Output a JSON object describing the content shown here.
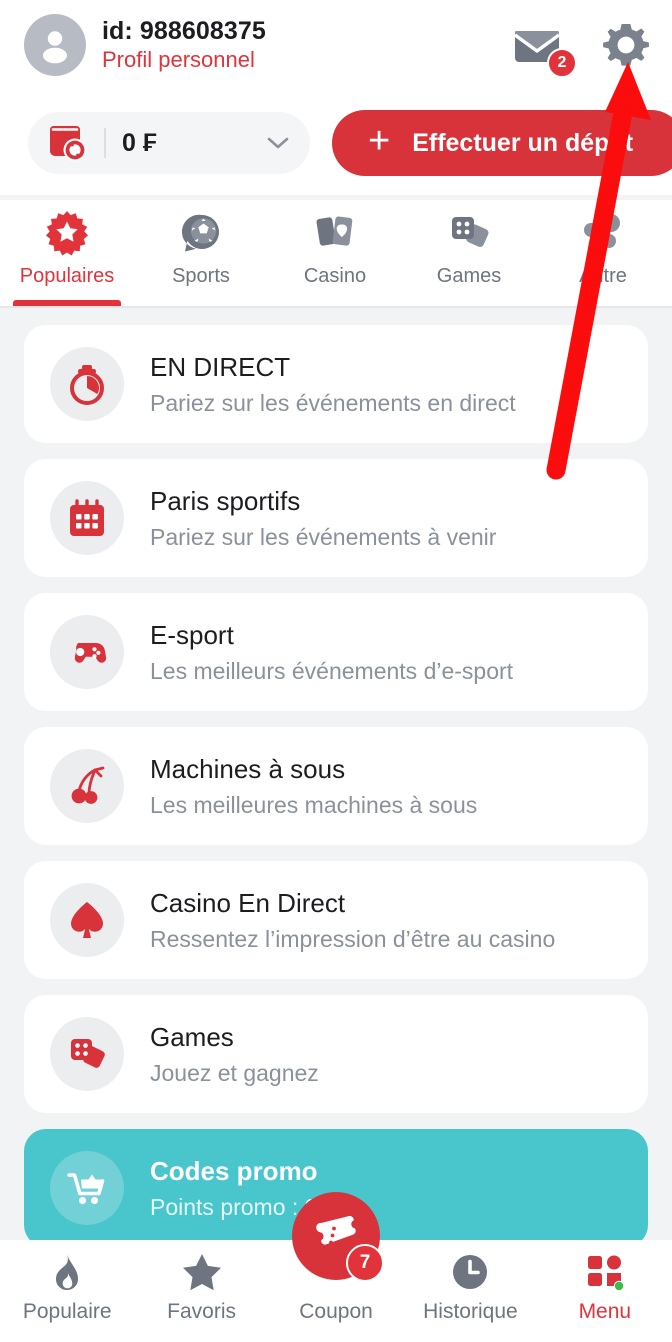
{
  "header": {
    "avatar_icon": "person-avatar-icon",
    "profile_id": "id: 988608375",
    "profile_link": "Profil personnel",
    "mail_icon": "mail-icon",
    "mail_badge": "2",
    "settings_icon": "gear-icon"
  },
  "balance": {
    "wallet_icon": "wallet-refresh-icon",
    "amount": "0 ₣",
    "chevron_icon": "chevron-down-icon",
    "deposit_plus": "+",
    "deposit_label": "Effectuer un dépôt"
  },
  "tabs": [
    {
      "label": "Populaires",
      "icon": "starburst-icon",
      "active": true
    },
    {
      "label": "Sports",
      "icon": "soccer-ball-bubble-icon",
      "active": false
    },
    {
      "label": "Casino",
      "icon": "playing-cards-icon",
      "active": false
    },
    {
      "label": "Games",
      "icon": "dice-icon",
      "active": false
    },
    {
      "label": "Autre",
      "icon": "more-dots-icon",
      "active": false
    }
  ],
  "list": [
    {
      "title": "EN DIRECT",
      "subtitle": "Pariez sur les événements en direct",
      "icon": "stopwatch-icon"
    },
    {
      "title": "Paris sportifs",
      "subtitle": "Pariez sur les événements à venir",
      "icon": "calendar-icon"
    },
    {
      "title": "E-sport",
      "subtitle": "Les meilleurs événements d’e-sport",
      "icon": "gamepad-icon"
    },
    {
      "title": "Machines à sous",
      "subtitle": "Les meilleures machines à sous",
      "icon": "cherries-icon"
    },
    {
      "title": "Casino En Direct",
      "subtitle": "Ressentez l’impression d’être au casino",
      "icon": "spade-icon"
    },
    {
      "title": "Games",
      "subtitle": "Jouez et gagnez",
      "icon": "dice-cards-icon"
    }
  ],
  "promo": {
    "title": "Codes promo",
    "subtitle": "Points promo : 0",
    "icon": "shopping-cart-icon",
    "color": "#49c5cc"
  },
  "bottom_nav": {
    "items": [
      {
        "label": "Populaire",
        "icon": "flame-icon",
        "active": false
      },
      {
        "label": "Favoris",
        "icon": "star-icon",
        "active": false
      },
      {
        "label": "Coupon",
        "icon": "ticket-icon",
        "active": false
      },
      {
        "label": "Historique",
        "icon": "clock-icon",
        "active": false
      },
      {
        "label": "Menu",
        "icon": "grid-menu-icon",
        "active": true
      }
    ],
    "coupon_badge": "7"
  },
  "colors": {
    "brand_red": "#e2333b",
    "deposit_red": "#d8333b",
    "promo_teal": "#49c5cc",
    "page_bg": "#f2f3f5",
    "muted_text": "#8b919c"
  },
  "annotation": {
    "arrow_icon": "red-arrow-pointer",
    "arrow_color": "#fb0d0d"
  }
}
